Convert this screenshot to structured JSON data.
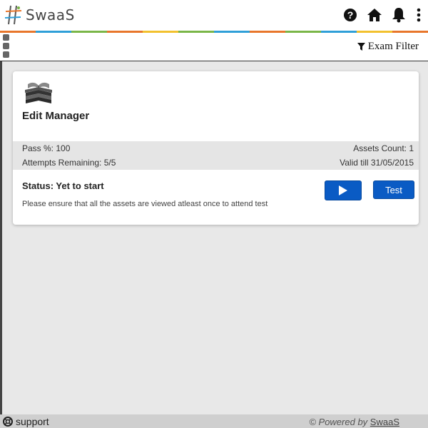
{
  "header": {
    "logo_text": "SwaaS",
    "icons": [
      "help-icon",
      "home-icon",
      "bell-icon",
      "more-vertical-icon"
    ],
    "stripe_colors": [
      "#e8762b",
      "#2f9fd8",
      "#7ab648",
      "#e8762b",
      "#f2c12e",
      "#7ab648",
      "#2f9fd8",
      "#e8762b",
      "#7ab648",
      "#2f9fd8",
      "#f2c12e",
      "#e8762b"
    ]
  },
  "filter_bar": {
    "exam_filter_label": "Exam Filter",
    "icon": "filter-icon"
  },
  "card": {
    "icon": "books-icon",
    "title": "Edit Manager",
    "pass_percent": "Pass %: 100",
    "assets_count": "Assets Count: 1",
    "attempts_remaining": "Attempts Remaining: 5/5",
    "valid_till": "Valid till 31/05/2015",
    "status": "Status: Yet to start",
    "note": "Please ensure that all the assets are viewed atleast once to attend test",
    "play_button_icon": "play-icon",
    "test_button_label": "Test",
    "accent_color": "#0a5bc4"
  },
  "footer": {
    "support_label": "support",
    "support_icon": "lifebuoy-icon",
    "powered_prefix": "© Powered by",
    "powered_brand": "SwaaS"
  }
}
